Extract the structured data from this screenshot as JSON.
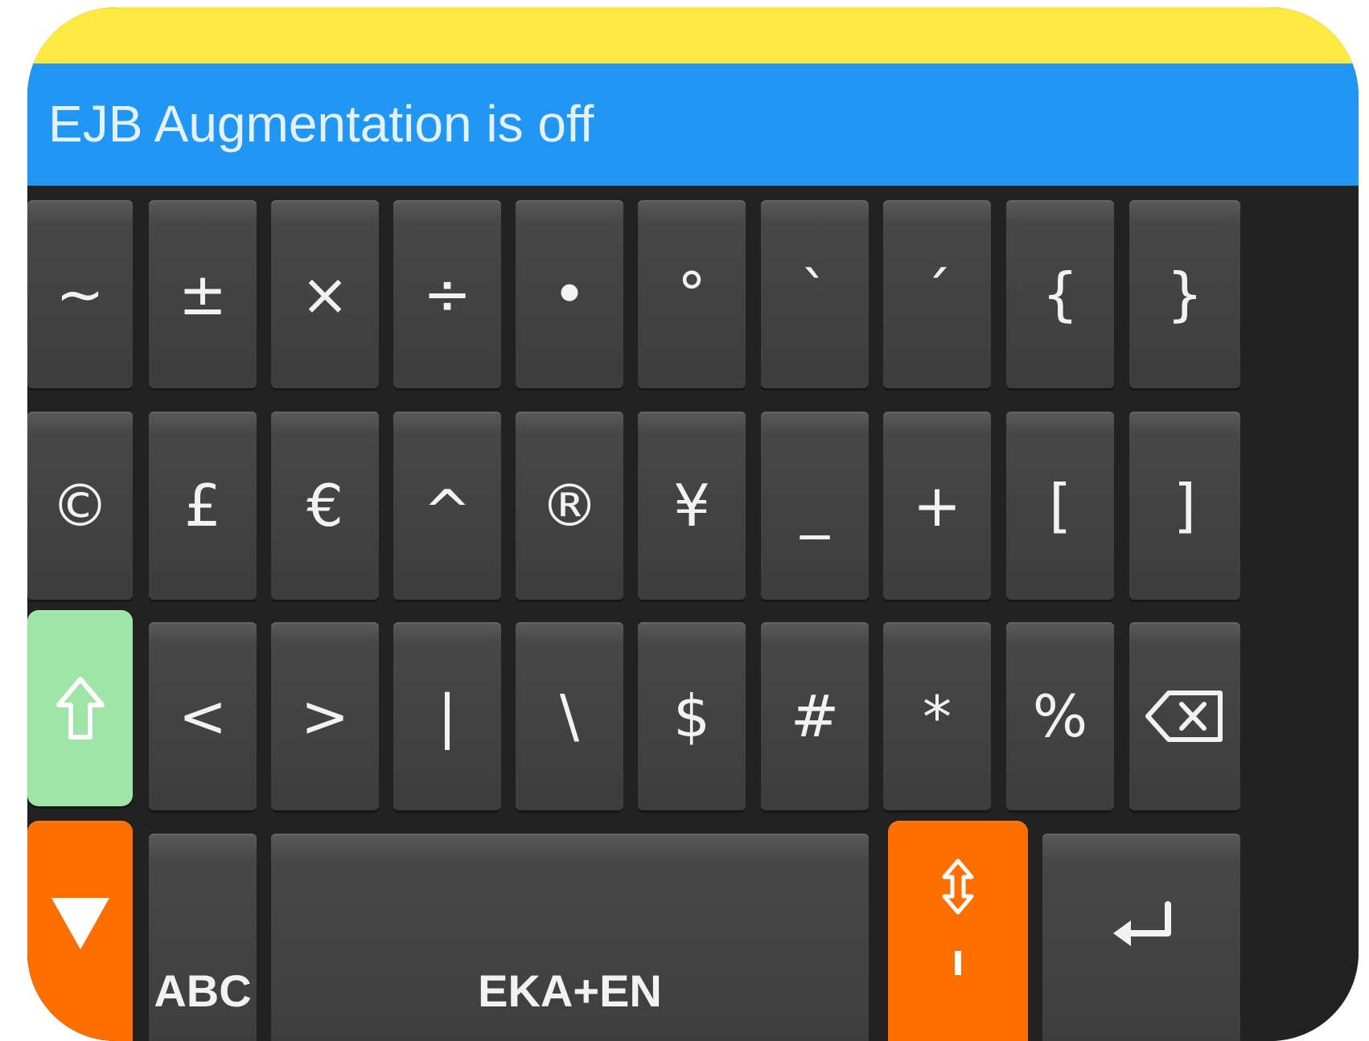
{
  "status": {
    "text": "EJB Augmentation is off"
  },
  "colors": {
    "top_bar": "#fde940",
    "status_bar": "#2196f3",
    "key": "#444444",
    "shift_key": "#9fe6a6",
    "accent_keys": "#ff6f00"
  },
  "keyboard": {
    "row1": [
      "~",
      "±",
      "×",
      "÷",
      "•",
      "°",
      "`",
      "´",
      "{",
      "}"
    ],
    "row2": [
      "©",
      "£",
      "€",
      "^",
      "®",
      "¥",
      "_",
      "+",
      "[",
      "]"
    ],
    "row3": [
      "<",
      ">",
      "|",
      "\\",
      "$",
      "#",
      "*",
      "%"
    ],
    "abc_label": "ABC",
    "space_label": "EKA+EN"
  },
  "icons": {
    "shift": "shift-arrow-icon",
    "backspace": "backspace-icon",
    "hide": "hide-keyboard-icon",
    "resize": "resize-updown-icon",
    "enter": "enter-icon"
  }
}
